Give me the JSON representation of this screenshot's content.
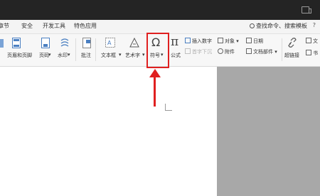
{
  "tabs": [
    "章节",
    "安全",
    "开发工具",
    "特色应用"
  ],
  "search": {
    "label": "查找命令、搜索模板"
  },
  "help": "?",
  "ribbon": {
    "header_footer": "页眉和页脚",
    "page_number": "页码",
    "watermark": "水印",
    "comment": "批注",
    "textbox": "文本框",
    "wordart": "艺术字",
    "symbol": "符号",
    "formula": "公式",
    "insert_number": "插入数字",
    "first_letter_sink": "首字下沉",
    "object": "对象",
    "attachment": "附件",
    "date": "日期",
    "doc_parts": "文档部件",
    "hyperlink": "超链接",
    "text_partial": "文",
    "bookmark_partial": "书",
    "symbol_glyph": "Ω",
    "formula_glyph": "π"
  },
  "colors": {
    "highlight": "#e02020",
    "topbar": "#242424",
    "ribbon": "#f7f7f7",
    "canvas": "#a8a8a8"
  }
}
